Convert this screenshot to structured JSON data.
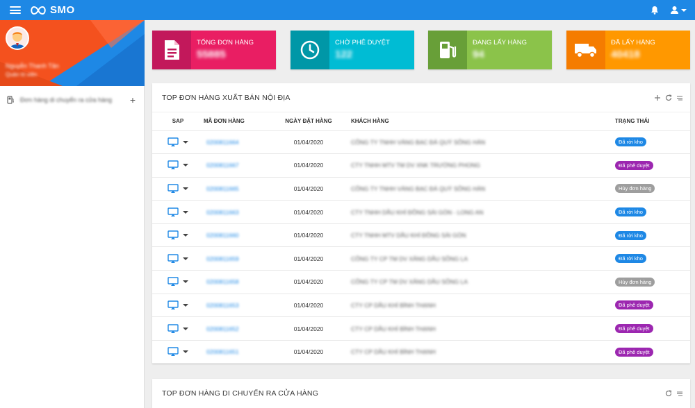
{
  "app": {
    "brand": "SMO",
    "accent": "#1e88e5"
  },
  "sidebar": {
    "user_name": "Nguyễn Thanh Tân",
    "user_role": "Quản trị viên",
    "menu_item": "Đơn hàng di chuyển ra cửa hàng"
  },
  "cards": [
    {
      "label": "TỔNG ĐƠN HÀNG",
      "value": "55885",
      "color": "#e91e63",
      "icon_bg": "#c2185b",
      "icon": "document-icon"
    },
    {
      "label": "CHỜ PHÊ DUYỆT",
      "value": "122",
      "color": "#00bcd4",
      "icon_bg": "#0097a7",
      "icon": "clock-icon"
    },
    {
      "label": "ĐANG LẤY HÀNG",
      "value": "94",
      "color": "#8bc34a",
      "icon_bg": "#689f38",
      "icon": "fuel-icon"
    },
    {
      "label": "ĐÃ LẤY HÀNG",
      "value": "40418",
      "color": "#ff9800",
      "icon_bg": "#f57c00",
      "icon": "truck-icon"
    }
  ],
  "panel1": {
    "title": "TOP ĐƠN HÀNG XUẤT BÁN NỘI ĐỊA",
    "columns": {
      "sap": "SAP",
      "code": "MÃ ĐƠN HÀNG",
      "date": "NGÀY ĐẶT HÀNG",
      "customer": "KHÁCH HÀNG",
      "status": "TRẠNG THÁI"
    },
    "rows": [
      {
        "code": "0200811664",
        "date": "01/04/2020",
        "customer": "CÔNG TY TNHH VÀNG BẠC ĐÁ QUÝ SÔNG HÀN",
        "status": "Đã rời kho",
        "status_color": "#1e88e5"
      },
      {
        "code": "0200811667",
        "date": "01/04/2020",
        "customer": "CTY TNHH MTV TM DV XNK TRƯỜNG PHONG",
        "status": "Đã phê duyệt",
        "status_color": "#9c27b0"
      },
      {
        "code": "0200811665",
        "date": "01/04/2020",
        "customer": "CÔNG TY TNHH VÀNG BẠC ĐÁ QUÝ SÔNG HÀN",
        "status": "Hủy đơn hàng",
        "status_color": "#9e9e9e"
      },
      {
        "code": "0200811663",
        "date": "01/04/2020",
        "customer": "CTY TNHH DẦU KHÍ ĐỒNG SÀI GÒN - LONG AN",
        "status": "Đã rời kho",
        "status_color": "#1e88e5"
      },
      {
        "code": "0200811660",
        "date": "01/04/2020",
        "customer": "CTY TNHH MTV DẦU KHÍ ĐỒNG SÀI GÒN",
        "status": "Đã rời kho",
        "status_color": "#1e88e5"
      },
      {
        "code": "0200811659",
        "date": "01/04/2020",
        "customer": "CÔNG TY CP TM DV XĂNG DẦU SÔNG LA",
        "status": "Đã rời kho",
        "status_color": "#1e88e5"
      },
      {
        "code": "0200811658",
        "date": "01/04/2020",
        "customer": "CÔNG TY CP TM DV XĂNG DẦU SÔNG LA",
        "status": "Hủy đơn hàng",
        "status_color": "#9e9e9e"
      },
      {
        "code": "0200811653",
        "date": "01/04/2020",
        "customer": "CTY CP DẦU KHÍ BÌNH THẠNH",
        "status": "Đã phê duyệt",
        "status_color": "#9c27b0"
      },
      {
        "code": "0200811652",
        "date": "01/04/2020",
        "customer": "CTY CP DẦU KHÍ BÌNH THẠNH",
        "status": "Đã phê duyệt",
        "status_color": "#9c27b0"
      },
      {
        "code": "0200811651",
        "date": "01/04/2020",
        "customer": "CTY CP DẦU KHÍ BÌNH THẠNH",
        "status": "Đã phê duyệt",
        "status_color": "#9c27b0"
      }
    ]
  },
  "panel2": {
    "title": "TOP ĐƠN HÀNG DI CHUYỂN RA CỬA HÀNG"
  }
}
